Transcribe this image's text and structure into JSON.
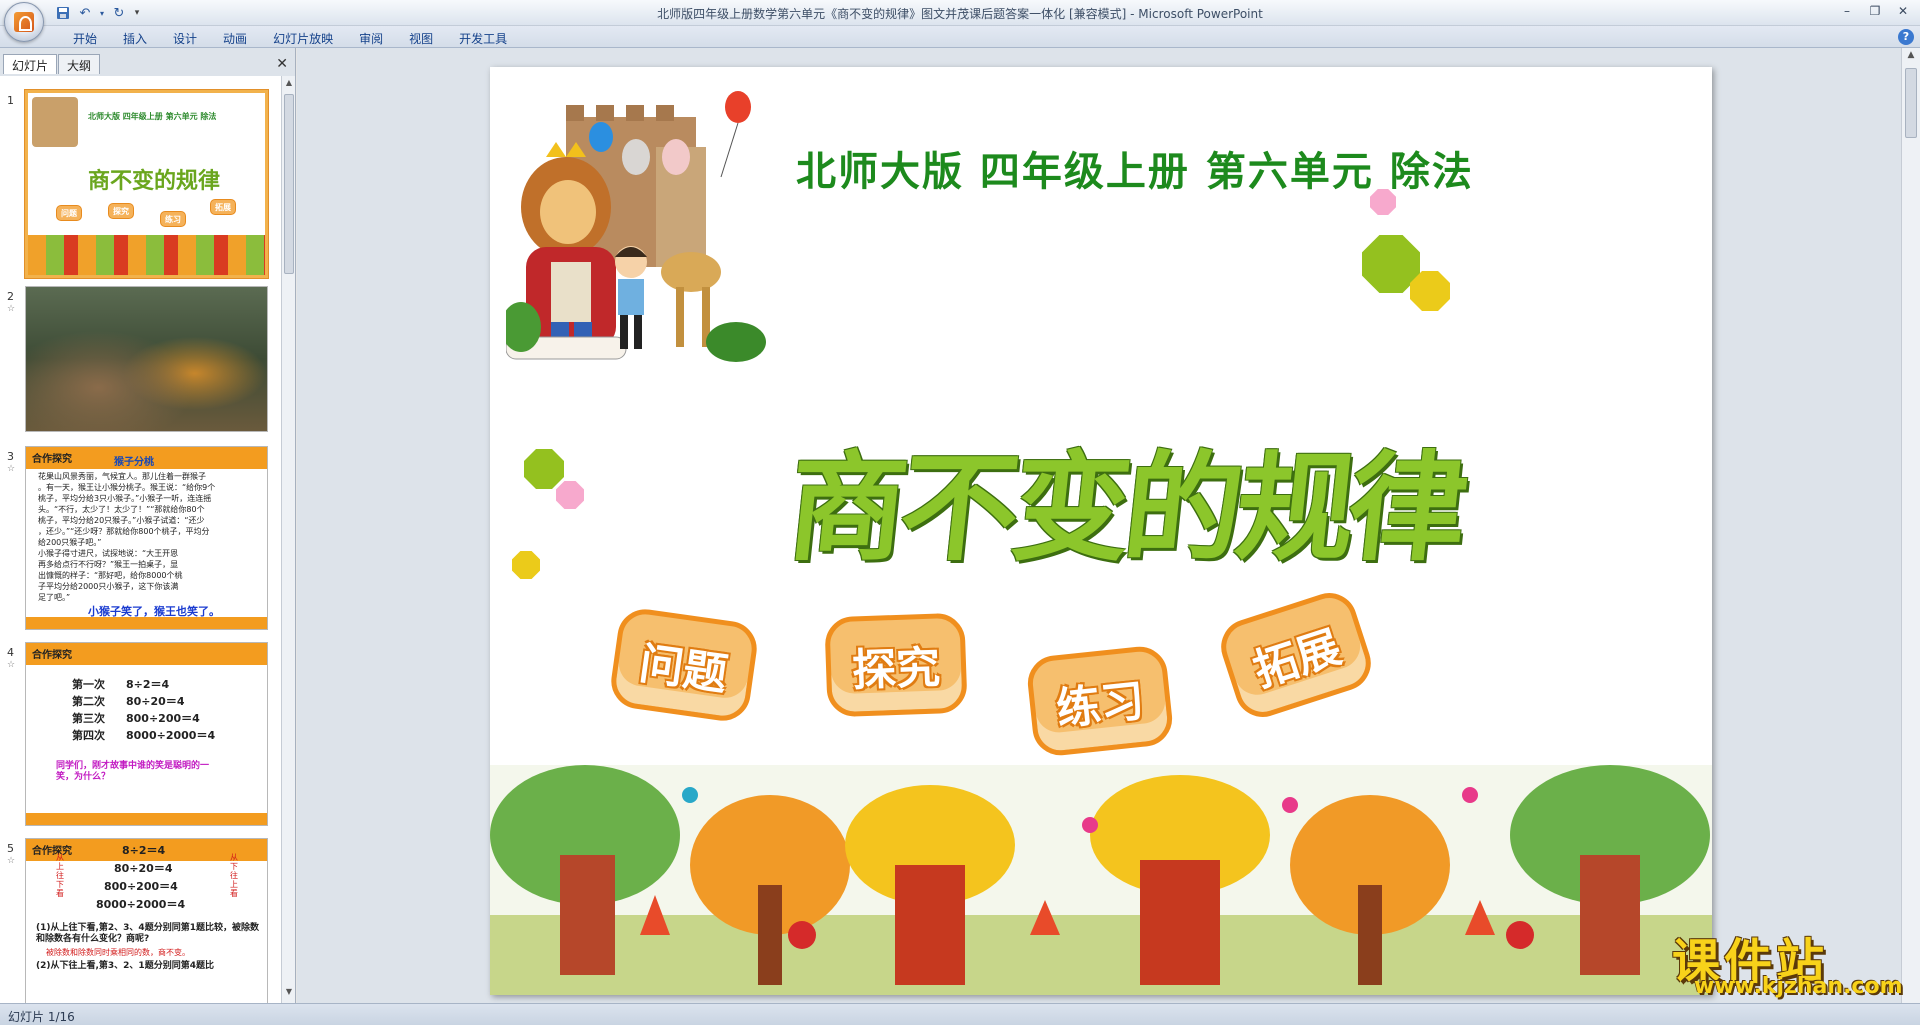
{
  "window": {
    "title": "北师版四年级上册数学第六单元《商不变的规律》图文并茂课后题答案一体化 [兼容模式] - Microsoft PowerPoint"
  },
  "ribbon": {
    "tabs": [
      "开始",
      "插入",
      "设计",
      "动画",
      "幻灯片放映",
      "审阅",
      "视图",
      "开发工具"
    ]
  },
  "left_pane": {
    "tabs": [
      "幻灯片",
      "大纲"
    ],
    "thumbnails": [
      {
        "num": "1",
        "small_title": "北师大版 四年级上册 第六单元 除法",
        "big_title": "商不变的规律",
        "chips": [
          "问题",
          "探究",
          "练习",
          "拓展"
        ]
      },
      {
        "num": "2"
      },
      {
        "num": "3",
        "heading": "合作探究",
        "subtitle": "猴子分桃",
        "lines": [
          "花果山风景秀丽，气候宜人。那儿住着一群猴子",
          "。有一天，猴王让小猴分桃子。猴王说：“给你9个",
          "桃子，平均分给3只小猴子。”小猴子一听，连连摇",
          "头。“不行，太少了！太少了！”“那就给你80个",
          "桃子，平均分给20只猴子。”小猴子试道：“还少",
          "，还少。”“还少呀？那就给你800个桃子，平均分",
          "给200只猴子吧。”",
          "小猴子得寸进尺，试探地说：“大王开恩",
          "再多给点行不行呀？”猴王一拍桌子，显",
          "出慷慨的样子：“那好吧，给你8000个桃",
          "子平均分给2000只小猴子，这下你该满",
          "足了吧。”"
        ],
        "footer": "小猴子笑了，猴王也笑了。"
      },
      {
        "num": "4",
        "heading": "合作探究",
        "rows": [
          [
            "第一次",
            "8÷2＝4"
          ],
          [
            "第二次",
            "80÷20＝4"
          ],
          [
            "第三次",
            "800÷200＝4"
          ],
          [
            "第四次",
            "8000÷2000＝4"
          ]
        ],
        "question": "同学们，刚才故事中谁的笑是聪明的一笑，为什么？"
      },
      {
        "num": "5",
        "heading": "合作探究",
        "eqs": [
          "8÷2＝4",
          "80÷20＝4",
          "800÷200＝4",
          "8000÷2000＝4"
        ],
        "side_left": "从上往下看",
        "side_right": "从下往上看",
        "q1": "(1)从上往下看,第2、3、4题分别同第1题比较，被除数和除数各有什么变化？商呢?",
        "a1": "被除数和除数同时乘相同的数，商不变。",
        "q2": "(2)从下往上看,第3、2、1题分别同第4题比"
      }
    ]
  },
  "slide": {
    "title": "北师大版  四年级上册  第六单元  除法",
    "heading": "商不变的规律",
    "buttons": [
      "问题",
      "探究",
      "练习",
      "拓展"
    ],
    "colors": {
      "title": "#1d8a1d",
      "heading": "#8cc62b",
      "bubble": "#f6bf6e",
      "bubble_border": "#f08f1e"
    }
  },
  "watermark": {
    "cn": "课件站",
    "url": "www.kjzhan.com"
  },
  "statusbar": {
    "slide_info": "幻灯片 1/16"
  }
}
